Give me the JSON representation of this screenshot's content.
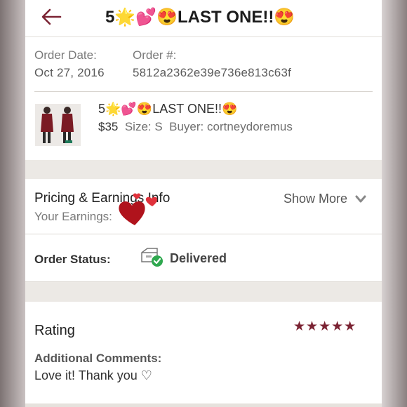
{
  "header": {
    "title": "5🌟💕😍LAST ONE!!😍",
    "back_icon": "back-arrow-icon",
    "accent_color": "#7b2333"
  },
  "order": {
    "date_label": "Order Date:",
    "date_value": "Oct 27, 2016",
    "number_label": "Order #:",
    "number_value": "5812a2362e39e736e813c63f"
  },
  "item": {
    "title": "5🌟💕😍LAST ONE!!😍",
    "price": "$35",
    "size": "Size: S",
    "buyer": "Buyer: cortneydoremus"
  },
  "pricing": {
    "title": "Pricing & Earnings Info",
    "earnings_label": "Your Earnings:",
    "show_more": "Show More"
  },
  "status": {
    "label": "Order Status:",
    "value": "Delivered",
    "icon": "delivered-package-icon"
  },
  "rating": {
    "title": "Rating",
    "stars": "★★★★★",
    "star_count": 5,
    "comments_label": "Additional Comments:",
    "comments_value": "Love it! Thank you ♡"
  }
}
